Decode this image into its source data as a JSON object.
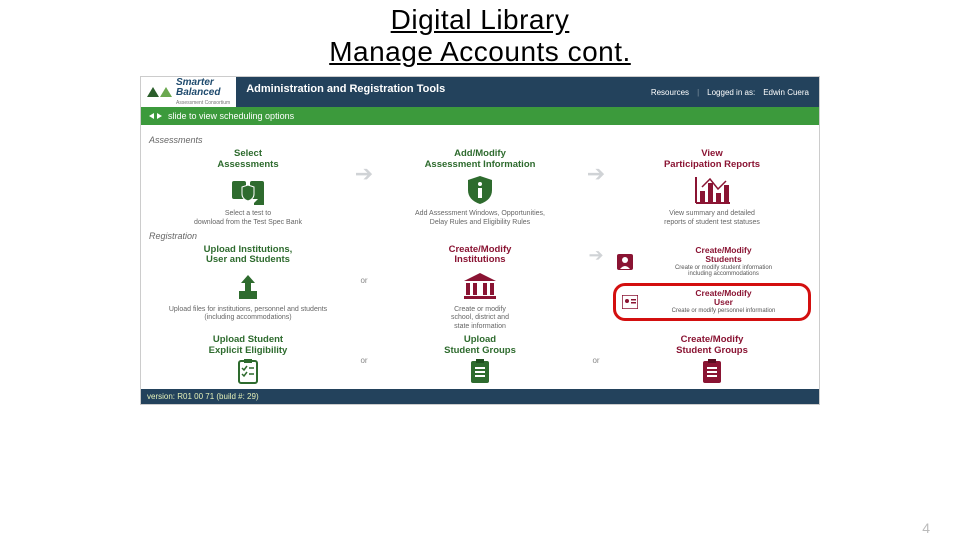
{
  "slide": {
    "title_line1": "Digital Library",
    "title_line2": "Manage Accounts cont.",
    "page_number": "4"
  },
  "app": {
    "logo_line1": "Smarter",
    "logo_line2": "Balanced",
    "logo_sub": "Assessment Consortium",
    "brand": "Administration and Registration Tools",
    "resources": "Resources",
    "logged_in_label": "Logged in as:",
    "logged_in_user": "Edwin Cuera",
    "greenbar": "slide to view scheduling options",
    "section_assessments": "Assessments",
    "section_registration": "Registration",
    "footer": "version: R01 00 71 (build #: 29)",
    "or_label": "or",
    "assess": {
      "select": {
        "title": "Select\nAssessments",
        "desc": "Select a test to\ndownload from the Test Spec Bank"
      },
      "addmod": {
        "title": "Add/Modify\nAssessment Information",
        "desc": "Add Assessment Windows, Opportunities,\nDelay Rules and Eligibility Rules"
      },
      "view": {
        "title": "View\nParticipation Reports",
        "desc": "View summary and detailed\nreports of student test statuses"
      }
    },
    "reg": {
      "upload_iu": {
        "title": "Upload Institutions,\nUser and Students",
        "desc": "Upload files for institutions, personnel and students\n(including accommodations)"
      },
      "cm_inst": {
        "title": "Create/Modify\nInstitutions",
        "desc": "Create or modify\nschool, district and\nstate information"
      },
      "cm_students": {
        "title": "Create/Modify\nStudents",
        "desc": "Create or modify student information\nincluding accommodations"
      },
      "cm_user": {
        "title": "Create/Modify\nUser",
        "desc": "Create or modify personnel information"
      },
      "upload_elig": {
        "title": "Upload Student\nExplicit Eligibility"
      },
      "upload_sg": {
        "title": "Upload\nStudent Groups"
      },
      "cm_sg": {
        "title": "Create/Modify\nStudent Groups"
      }
    }
  }
}
